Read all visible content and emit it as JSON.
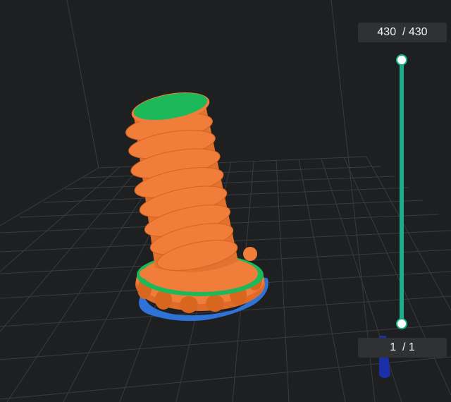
{
  "layer_slider": {
    "top_current": "430",
    "top_total": "430",
    "top_text": "430  / 430",
    "bottom_current": "1",
    "bottom_total": "1",
    "bottom_text": "1  / 1"
  },
  "colors": {
    "background": "#1e1f21",
    "grid_line": "#3a3b3d",
    "model_wall": "#f07d3a",
    "model_top_bottom": "#1db85a",
    "skirt": "#2f73d8",
    "slider_accent": "#17b08a",
    "axis_indicator": "#1a2fa8"
  },
  "icons": {
    "axis_indicator": "z-axis-cone-icon"
  }
}
